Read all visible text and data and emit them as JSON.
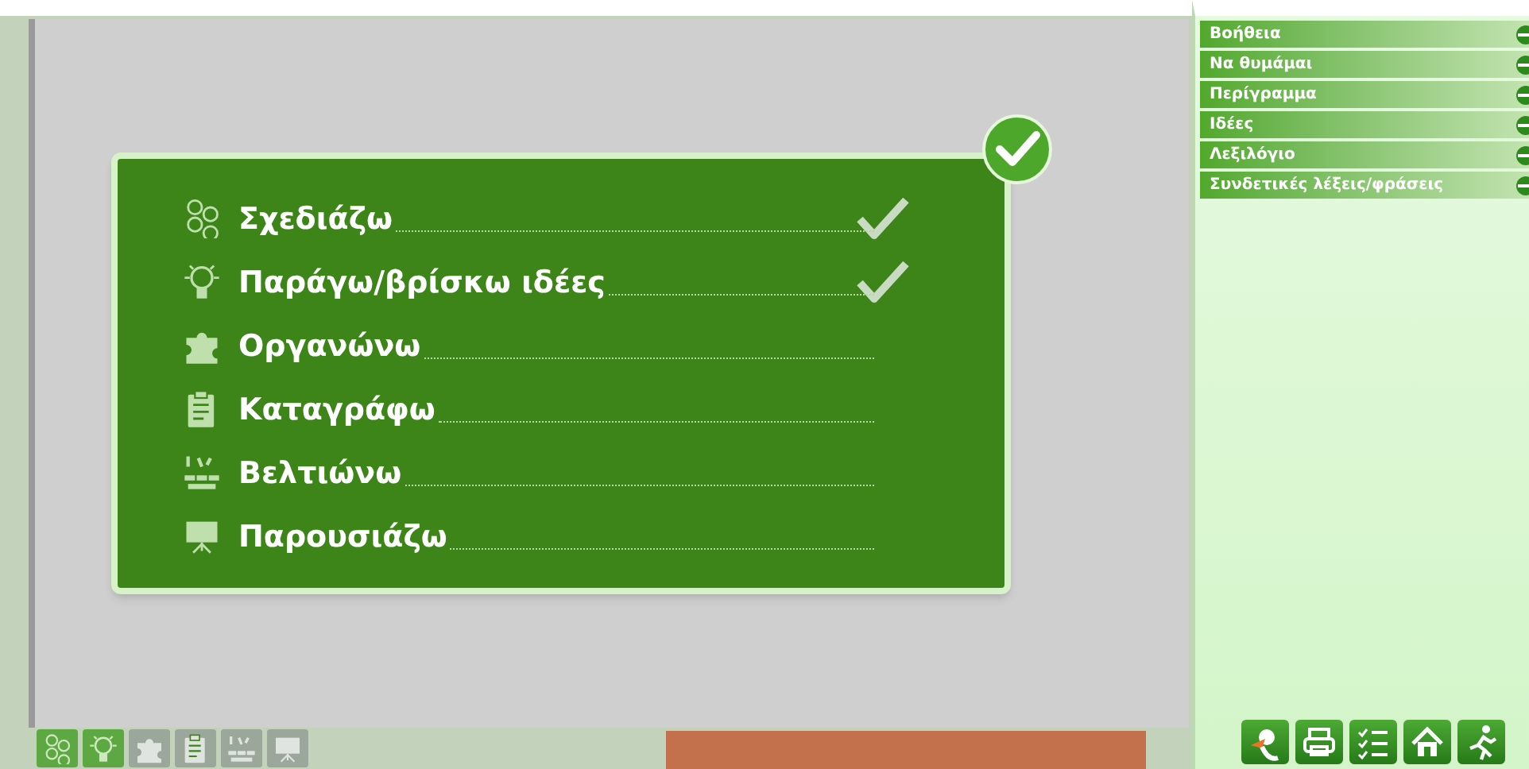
{
  "menu": [
    {
      "label": "Βοήθεια"
    },
    {
      "label": "Να θυμάμαι"
    },
    {
      "label": "Περίγραμμα"
    },
    {
      "label": "Ιδέες"
    },
    {
      "label": "Λεξιλόγιο"
    },
    {
      "label": "Συνδετικές λέξεις/φράσεις"
    }
  ],
  "card": {
    "complete": true
  },
  "steps": [
    {
      "kind": "plan",
      "label": "Σχεδιάζω",
      "done": true
    },
    {
      "kind": "ideas",
      "label": "Παράγω/βρίσκω ιδέες",
      "done": true
    },
    {
      "kind": "organize",
      "label": "Οργανώνω",
      "done": false
    },
    {
      "kind": "write",
      "label": "Καταγράφω",
      "done": false
    },
    {
      "kind": "improve",
      "label": "Βελτιώνω",
      "done": false
    },
    {
      "kind": "present",
      "label": "Παρουσιάζω",
      "done": false
    }
  ],
  "tools": [
    {
      "kind": "mascot"
    },
    {
      "kind": "print"
    },
    {
      "kind": "checklist"
    },
    {
      "kind": "home"
    },
    {
      "kind": "exit"
    }
  ]
}
